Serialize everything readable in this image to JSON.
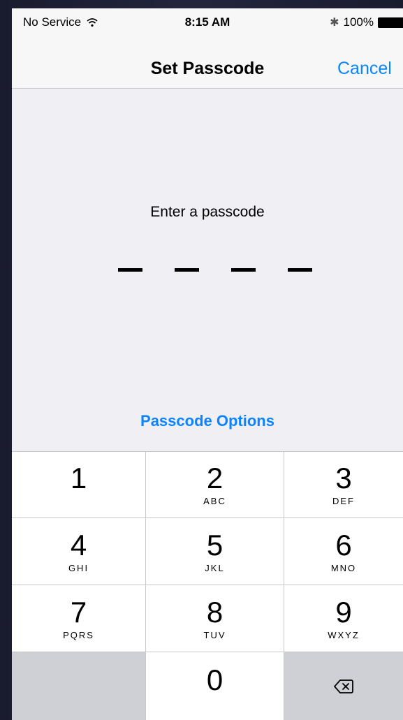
{
  "status_bar": {
    "carrier": "No Service",
    "wifi_icon": "wifi-icon",
    "time": "8:15 AM",
    "bluetooth_icon": "bluetooth-icon",
    "battery_percent": "100%",
    "battery_level": 1.0
  },
  "nav": {
    "title": "Set Passcode",
    "cancel_label": "Cancel"
  },
  "passcode": {
    "prompt": "Enter a passcode",
    "digits_total": 4,
    "digits_entered": 0
  },
  "options_label": "Passcode Options",
  "keypad": {
    "keys": [
      {
        "num": "1",
        "letters": ""
      },
      {
        "num": "2",
        "letters": "ABC"
      },
      {
        "num": "3",
        "letters": "DEF"
      },
      {
        "num": "4",
        "letters": "GHI"
      },
      {
        "num": "5",
        "letters": "JKL"
      },
      {
        "num": "6",
        "letters": "MNO"
      },
      {
        "num": "7",
        "letters": "PQRS"
      },
      {
        "num": "8",
        "letters": "TUV"
      },
      {
        "num": "9",
        "letters": "WXYZ"
      },
      {
        "num": "0",
        "letters": ""
      }
    ],
    "delete_icon": "backspace-icon"
  },
  "colors": {
    "accent": "#0a84ff",
    "background": "#efeff4",
    "keypad_key": "#ffffff",
    "keypad_function_key": "#cfd0d6"
  }
}
